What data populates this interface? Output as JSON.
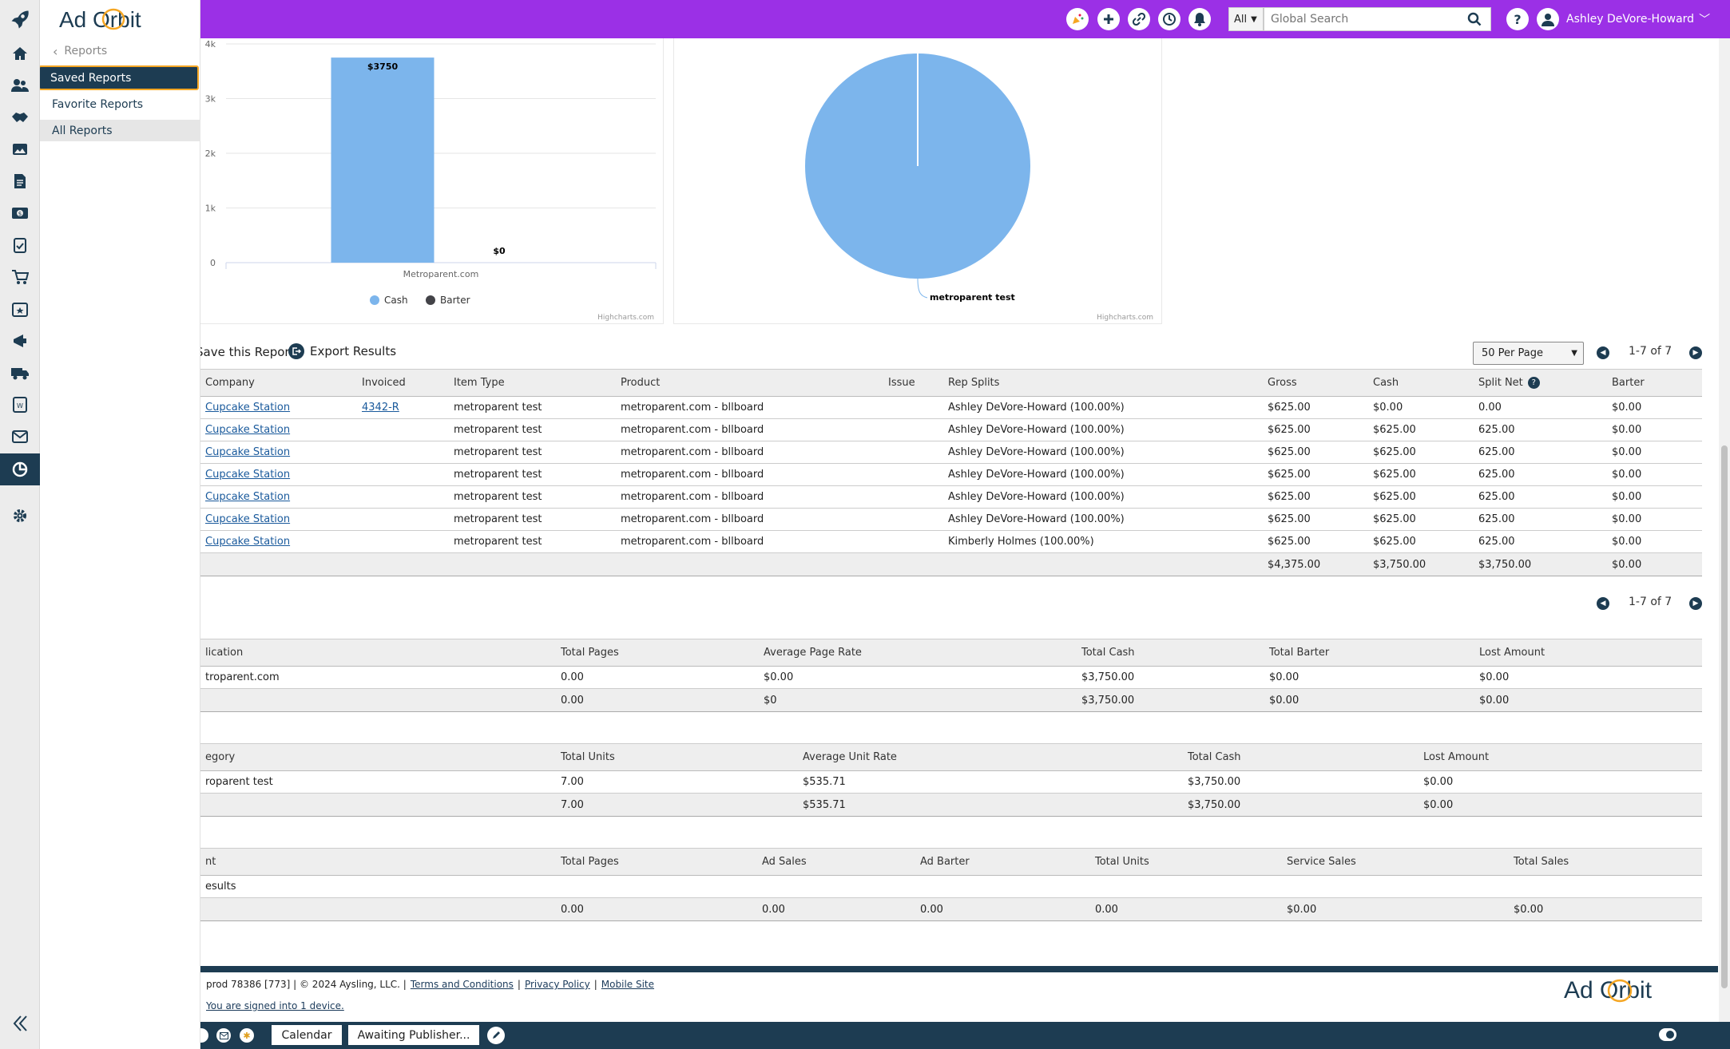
{
  "app": {
    "logo": "Ad Orbit"
  },
  "nav": {
    "back": "Reports",
    "items": [
      "Saved Reports",
      "Favorite Reports",
      "All Reports"
    ]
  },
  "header": {
    "search_scope": "All",
    "search_placeholder": "Global Search",
    "user": "Ashley DeVore-Howard"
  },
  "colors": {
    "topbar": "#9b30e6",
    "cash": "#7cb5ec",
    "barter": "#434348",
    "navy": "#1d3c52",
    "active_outline": "#f5a623"
  },
  "icons": {
    "sidebar": [
      "rocket-icon",
      "home-icon",
      "contacts-icon",
      "deals-icon",
      "gallery-icon",
      "orders-icon",
      "billing-icon",
      "tasks-icon",
      "cart-icon",
      "calendar-icon",
      "campaign-icon",
      "delivery-icon",
      "forms-icon",
      "mail-icon",
      "reports-icon",
      "settings-icon"
    ],
    "header": [
      "announcement-icon",
      "add-icon",
      "link-icon",
      "history-icon",
      "bell-icon",
      "search-icon",
      "help-icon",
      "user-icon"
    ]
  },
  "chart_data": [
    {
      "type": "bar",
      "categories": [
        "Metroparent.com"
      ],
      "series": [
        {
          "name": "Cash",
          "values": [
            3750
          ]
        },
        {
          "name": "Barter",
          "values": [
            0
          ]
        }
      ],
      "data_labels": [
        "$3750",
        "$0"
      ],
      "yticks": [
        "0",
        "1k",
        "2k",
        "3k",
        "4k"
      ],
      "ylim": [
        0,
        4000
      ],
      "legend": "bottom",
      "credit": "Highcharts.com"
    },
    {
      "type": "pie",
      "slices": [
        {
          "name": "metroparent test",
          "value": 3750
        }
      ],
      "credit": "Highcharts.com"
    }
  ],
  "actions": {
    "save": "Save this Report",
    "export": "Export Results"
  },
  "pagination": {
    "per_page": "50 Per Page",
    "range": "1-7 of 7"
  },
  "results": {
    "columns": [
      "Company",
      "Invoiced",
      "Item Type",
      "Product",
      "Issue",
      "Rep Splits",
      "Gross",
      "Cash",
      "Split Net",
      "Barter"
    ],
    "rows": [
      [
        "Cupcake Station",
        "4342-R",
        "metroparent test",
        "metroparent.com - bllboard",
        "",
        "Ashley DeVore-Howard (100.00%)",
        "$625.00",
        "$0.00",
        "0.00",
        "$0.00"
      ],
      [
        "Cupcake Station",
        "",
        "metroparent test",
        "metroparent.com - bllboard",
        "",
        "Ashley DeVore-Howard (100.00%)",
        "$625.00",
        "$625.00",
        "625.00",
        "$0.00"
      ],
      [
        "Cupcake Station",
        "",
        "metroparent test",
        "metroparent.com - bllboard",
        "",
        "Ashley DeVore-Howard (100.00%)",
        "$625.00",
        "$625.00",
        "625.00",
        "$0.00"
      ],
      [
        "Cupcake Station",
        "",
        "metroparent test",
        "metroparent.com - bllboard",
        "",
        "Ashley DeVore-Howard (100.00%)",
        "$625.00",
        "$625.00",
        "625.00",
        "$0.00"
      ],
      [
        "Cupcake Station",
        "",
        "metroparent test",
        "metroparent.com - bllboard",
        "",
        "Ashley DeVore-Howard (100.00%)",
        "$625.00",
        "$625.00",
        "625.00",
        "$0.00"
      ],
      [
        "Cupcake Station",
        "",
        "metroparent test",
        "metroparent.com - bllboard",
        "",
        "Ashley DeVore-Howard (100.00%)",
        "$625.00",
        "$625.00",
        "625.00",
        "$0.00"
      ],
      [
        "Cupcake Station",
        "",
        "metroparent test",
        "metroparent.com - bllboard",
        "",
        "Kimberly Holmes (100.00%)",
        "$625.00",
        "$625.00",
        "625.00",
        "$0.00"
      ]
    ],
    "total": [
      "",
      "",
      "",
      "",
      "",
      "",
      "$4,375.00",
      "$3,750.00",
      "$3,750.00",
      "$0.00"
    ]
  },
  "publication_summary": {
    "columns": [
      "lication",
      "Total Pages",
      "Average Page Rate",
      "Total Cash",
      "Total Barter",
      "Lost Amount"
    ],
    "rows": [
      [
        "troparent.com",
        "0.00",
        "$0.00",
        "$3,750.00",
        "$0.00",
        "$0.00"
      ]
    ],
    "total": [
      "",
      "0.00",
      "$0",
      "$3,750.00",
      "$0.00",
      "$0.00"
    ]
  },
  "category_summary": {
    "columns": [
      "egory",
      "Total Units",
      "Average Unit Rate",
      "Total Cash",
      "Lost Amount"
    ],
    "rows": [
      [
        "roparent test",
        "7.00",
        "$535.71",
        "$3,750.00",
        "$0.00"
      ]
    ],
    "total": [
      "",
      "7.00",
      "$535.71",
      "$3,750.00",
      "$0.00"
    ]
  },
  "rep_summary": {
    "columns": [
      "nt",
      "Total Pages",
      "Ad Sales",
      "Ad Barter",
      "Total Units",
      "Service Sales",
      "Total Sales"
    ],
    "rows": [
      [
        "esults",
        "",
        "",
        "",
        "",
        "",
        ""
      ]
    ],
    "total": [
      "",
      "0.00",
      "0.00",
      "0.00",
      "0.00",
      "$0.00",
      "$0.00"
    ]
  },
  "footer": {
    "info": "prod 78386 [773] | © 2024 Aysling, LLC. |",
    "links": [
      "Terms and Conditions",
      "Privacy Policy",
      "Mobile Site"
    ],
    "signed_in": "You are signed into 1 device.",
    "logo": "Ad Orbit"
  },
  "taskbar": {
    "tabs": [
      "Calendar",
      "Awaiting Publisher..."
    ]
  }
}
